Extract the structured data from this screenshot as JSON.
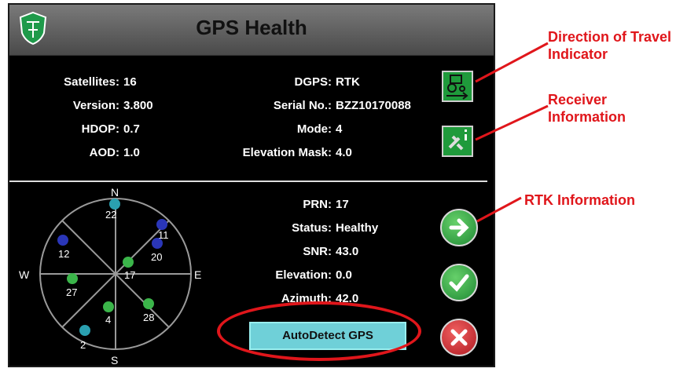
{
  "header": {
    "title": "GPS Health"
  },
  "info_left": [
    {
      "label": "Satellites:",
      "value": "16"
    },
    {
      "label": "Version:",
      "value": "3.800"
    },
    {
      "label": "HDOP:",
      "value": "0.7"
    },
    {
      "label": "AOD:",
      "value": "1.0"
    }
  ],
  "info_right": [
    {
      "label": "DGPS:",
      "value": "RTK"
    },
    {
      "label": "Serial No.:",
      "value": "BZZ10170088"
    },
    {
      "label": "Mode:",
      "value": "4"
    },
    {
      "label": "Elevation Mask:",
      "value": "4.0"
    }
  ],
  "sat_info": [
    {
      "label": "PRN:",
      "value": "17"
    },
    {
      "label": "Status:",
      "value": "Healthy"
    },
    {
      "label": "SNR:",
      "value": "43.0"
    },
    {
      "label": "Elevation:",
      "value": "0.0"
    },
    {
      "label": "Azimuth:",
      "value": "42.0"
    }
  ],
  "skyplot": {
    "compass": {
      "n": "N",
      "s": "S",
      "e": "E",
      "w": "W"
    },
    "satellites": [
      "22",
      "11",
      "12",
      "20",
      "17",
      "27",
      "28",
      "4",
      "2"
    ]
  },
  "buttons": {
    "autodetect": "AutoDetect GPS"
  },
  "callouts": {
    "direction": "Direction of Travel Indicator",
    "receiver": "Receiver Information",
    "rtk": "RTK Information"
  },
  "colors": {
    "blue_sat": "#2a36b8",
    "green_sat": "#3bb54a",
    "cyan_sat": "#2aa0b0",
    "callout": "#e0161b"
  }
}
